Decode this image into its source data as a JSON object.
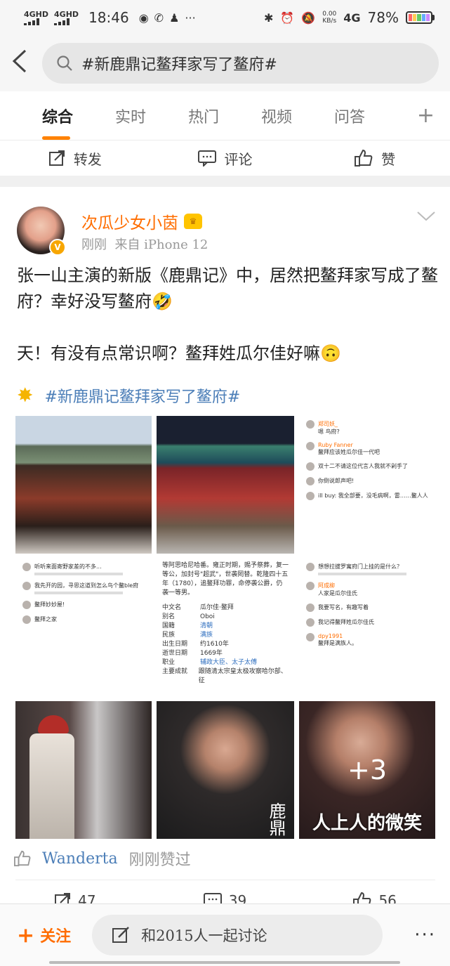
{
  "status_bar": {
    "signal1_type": "4GHD",
    "signal2_type": "4GHD",
    "time": "18:46",
    "dots": "···",
    "net_speed_value": "0.00",
    "net_speed_unit": "KB/s",
    "network": "4G",
    "battery": "78%"
  },
  "header": {
    "back_glyph": "‹",
    "search_query": "#新鹿鼎记鳌拜家写了鳌府#"
  },
  "tabs": [
    {
      "label": "综合",
      "active": true
    },
    {
      "label": "实时"
    },
    {
      "label": "热门"
    },
    {
      "label": "视频"
    },
    {
      "label": "问答"
    }
  ],
  "tab_add": "+",
  "prev_actions": {
    "repost": "转发",
    "comment": "评论",
    "like": "赞"
  },
  "post": {
    "username": "次瓜少女小茵",
    "time": "刚刚",
    "source": "来自 iPhone 12",
    "text_lines": [
      "张一山主演的新版《鹿鼎记》中，居然把鳌拜家写成了鳌府？幸好没写鳌府🤣",
      "",
      "天！有没有点常识啊？鳌拜姓瓜尔佳好嘛🙃"
    ],
    "topic": "#新鹿鼎记鳌拜家写了鳌府#",
    "images": {
      "c_comments": [
        {
          "name": "郑司妖_",
          "text": "嗯 鸟府?"
        },
        {
          "name": "Ruby Fanner",
          "text": "鳌拜应该姓瓜尔佳一代吧"
        },
        {
          "name": "",
          "text": "双十二不请这位代言人我就不剁手了"
        },
        {
          "name": "",
          "text": "你倒说郎声吧!"
        },
        {
          "name": "",
          "text": "ill buy: 我全部要，没毛病啊，雷……鳌人人"
        }
      ],
      "d_comments": [
        {
          "name": "",
          "text": "听听来面寄野家差的不多..."
        },
        {
          "name": "",
          "text": "我先开的园，寻思这道到怎么鸟个鳌ble府"
        },
        {
          "name": "",
          "text": "鳌拜妙妙屋!"
        },
        {
          "name": "",
          "text": "鳌拜之家"
        }
      ],
      "e_intro": "等阿思哈尼哈番。雍正时期，赐予祭葬，复一等公，加封号\"超武\"，世袭罔替。乾隆四十五年（1780），追鳌拜功罪，命停袭公爵，仍袭一等男。",
      "e_rows": [
        {
          "k": "中文名",
          "v": "瓜尔佳·鳌拜",
          "link": false
        },
        {
          "k": "别名",
          "v": "Oboi",
          "link": false
        },
        {
          "k": "国籍",
          "v": "清朝",
          "link": true
        },
        {
          "k": "民族",
          "v": "满族",
          "link": true
        },
        {
          "k": "出生日期",
          "v": "约1610年",
          "link": false
        },
        {
          "k": "逝世日期",
          "v": "1669年",
          "link": false
        },
        {
          "k": "职业",
          "v": "辅政大臣、太子太傅",
          "link": true
        },
        {
          "k": "主要成就",
          "v": "跟随清太宗皇太极攻察哈尔部、征",
          "link": false
        }
      ],
      "f_comments": [
        {
          "name": "",
          "text": "想想拉拔罗寓府门上挂的是什么？"
        },
        {
          "name": "阿成柳",
          "text": "人家是瓜尔佳氏"
        },
        {
          "name": "",
          "text": "我要写名，有趣写着"
        },
        {
          "name": "",
          "text": "我记得鳌拜姓瓜尔佳氏"
        },
        {
          "name": "dpy1991",
          "text": "鳌拜是满族人。"
        }
      ],
      "h_caption": "鹿鼎",
      "i_caption": "人上人的微笑",
      "more_count": "+3"
    },
    "liked_by": "Wanderta",
    "liked_suffix": "刚刚赞过",
    "repost_count": "47",
    "comment_count": "39",
    "like_count": "56"
  },
  "bottom_bar": {
    "follow_plus": "+",
    "follow": "关注",
    "discuss": "和2015人一起讨论",
    "more": "···"
  },
  "colors": {
    "accent": "#ff8200",
    "username": "#ff6d00",
    "topic_link": "#4d7fb8"
  }
}
